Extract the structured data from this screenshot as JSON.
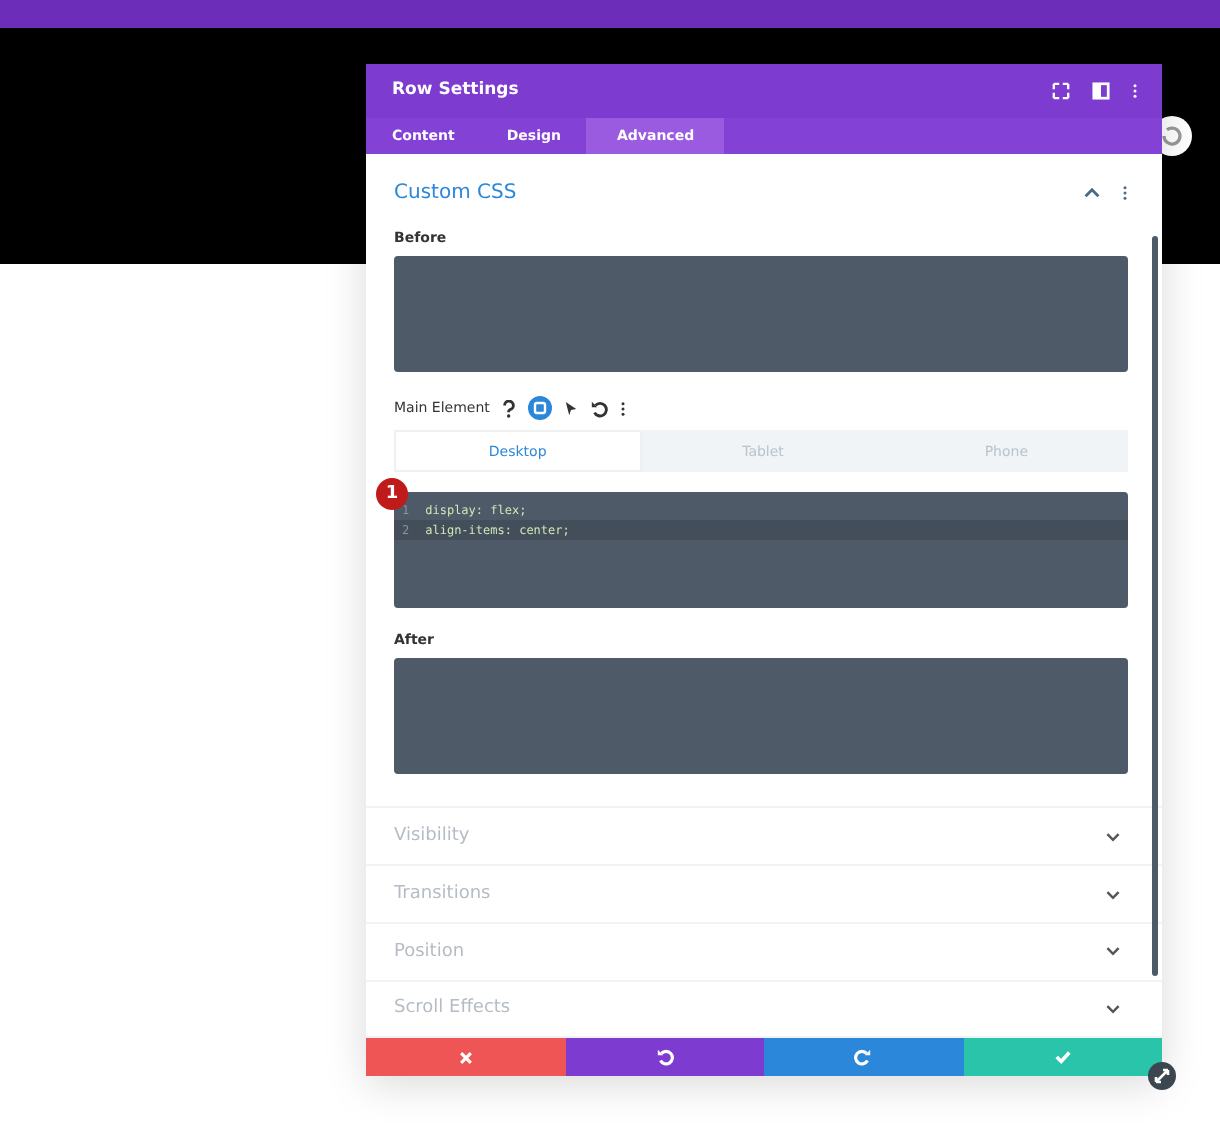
{
  "window": {
    "title": "Row Settings"
  },
  "tabs": [
    {
      "label": "Content",
      "selected": false
    },
    {
      "label": "Design",
      "selected": false
    },
    {
      "label": "Advanced",
      "selected": true
    }
  ],
  "section": {
    "title": "Custom CSS",
    "expanded": true
  },
  "before": {
    "label": "Before"
  },
  "main_element": {
    "label": "Main Element",
    "device_tabs": [
      {
        "label": "Desktop",
        "selected": true
      },
      {
        "label": "Tablet",
        "selected": false
      },
      {
        "label": "Phone",
        "selected": false
      }
    ],
    "badge": "1",
    "code_lines": [
      {
        "number": "1",
        "text": "display: flex;",
        "active": false
      },
      {
        "number": "2",
        "text": "align-items: center;",
        "active": true
      }
    ]
  },
  "after": {
    "label": "After"
  },
  "collapsed_sections": [
    {
      "title": "Visibility"
    },
    {
      "title": "Transitions"
    },
    {
      "title": "Position"
    },
    {
      "title": "Scroll Effects"
    }
  ],
  "footer_buttons": [
    {
      "kind": "cancel"
    },
    {
      "kind": "undo"
    },
    {
      "kind": "redo"
    },
    {
      "kind": "save"
    }
  ]
}
